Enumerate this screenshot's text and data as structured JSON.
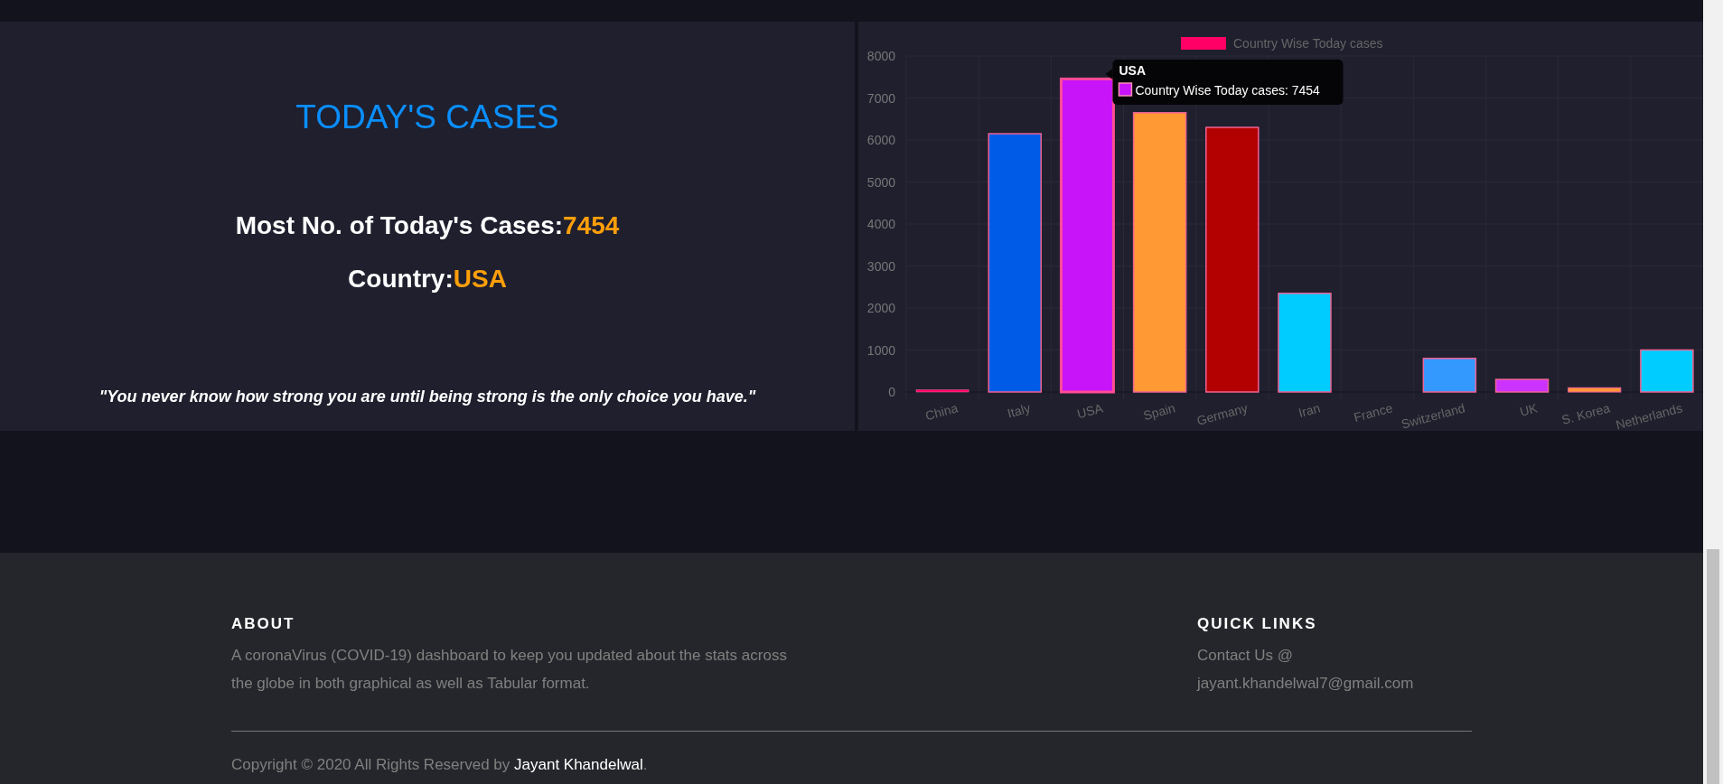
{
  "todays_cases": {
    "title": "TODAY'S CASES",
    "most_cases_label": "Most No. of Today's Cases:",
    "most_cases_value": "7454",
    "country_label": "Country:",
    "country_value": "USA",
    "quote": "\"You never know how strong you are until being strong is the only choice you have.\""
  },
  "chart": {
    "chart_data": {
      "type": "bar",
      "categories": [
        "China",
        "Italy",
        "USA",
        "Spain",
        "Germany",
        "Iran",
        "France",
        "Switzerland",
        "UK",
        "S. Korea",
        "Netherlands"
      ],
      "series": [
        {
          "name": "Country Wise Today cases",
          "values": [
            50,
            6150,
            7454,
            6650,
            6300,
            2350,
            0,
            800,
            300,
            100,
            1000
          ]
        }
      ],
      "ylim": [
        0,
        8000
      ],
      "yticks": [
        0,
        1000,
        2000,
        3000,
        4000,
        5000,
        6000,
        7000,
        8000
      ],
      "grid": true
    },
    "bars": [
      {
        "color": "#ff0066",
        "hovered": false
      },
      {
        "color": "#005ce6",
        "hovered": false
      },
      {
        "color": "#c814f9",
        "hovered": true
      },
      {
        "color": "#ff9933",
        "hovered": false
      },
      {
        "color": "#b30000",
        "hovered": false
      },
      {
        "color": "#00ccff",
        "hovered": false
      },
      {
        "hovered": false
      },
      {
        "color": "#3399ff",
        "hovered": false
      },
      {
        "color": "#cc33ff",
        "hovered": false
      },
      {
        "color": "#ff9933",
        "hovered": false
      },
      {
        "color": "#00ccff",
        "hovered": false
      }
    ],
    "tooltip": {
      "title": "USA",
      "label": "Country Wise Today cases: 7454"
    }
  },
  "footer": {
    "about": {
      "heading": "ABOUT",
      "text": "A coronaVirus (COVID-19) dashboard to keep you updated about the stats across the globe in both graphical as well as Tabular format."
    },
    "quick_links": {
      "heading": "QUICK LINKS",
      "lines": [
        "Contact Us @",
        "jayant.khandelwal7@gmail.com"
      ]
    },
    "copyright": {
      "text": "Copyright © 2020 All Rights Reserved by ",
      "author": "Jayant Khandelwal",
      "end": "."
    }
  }
}
